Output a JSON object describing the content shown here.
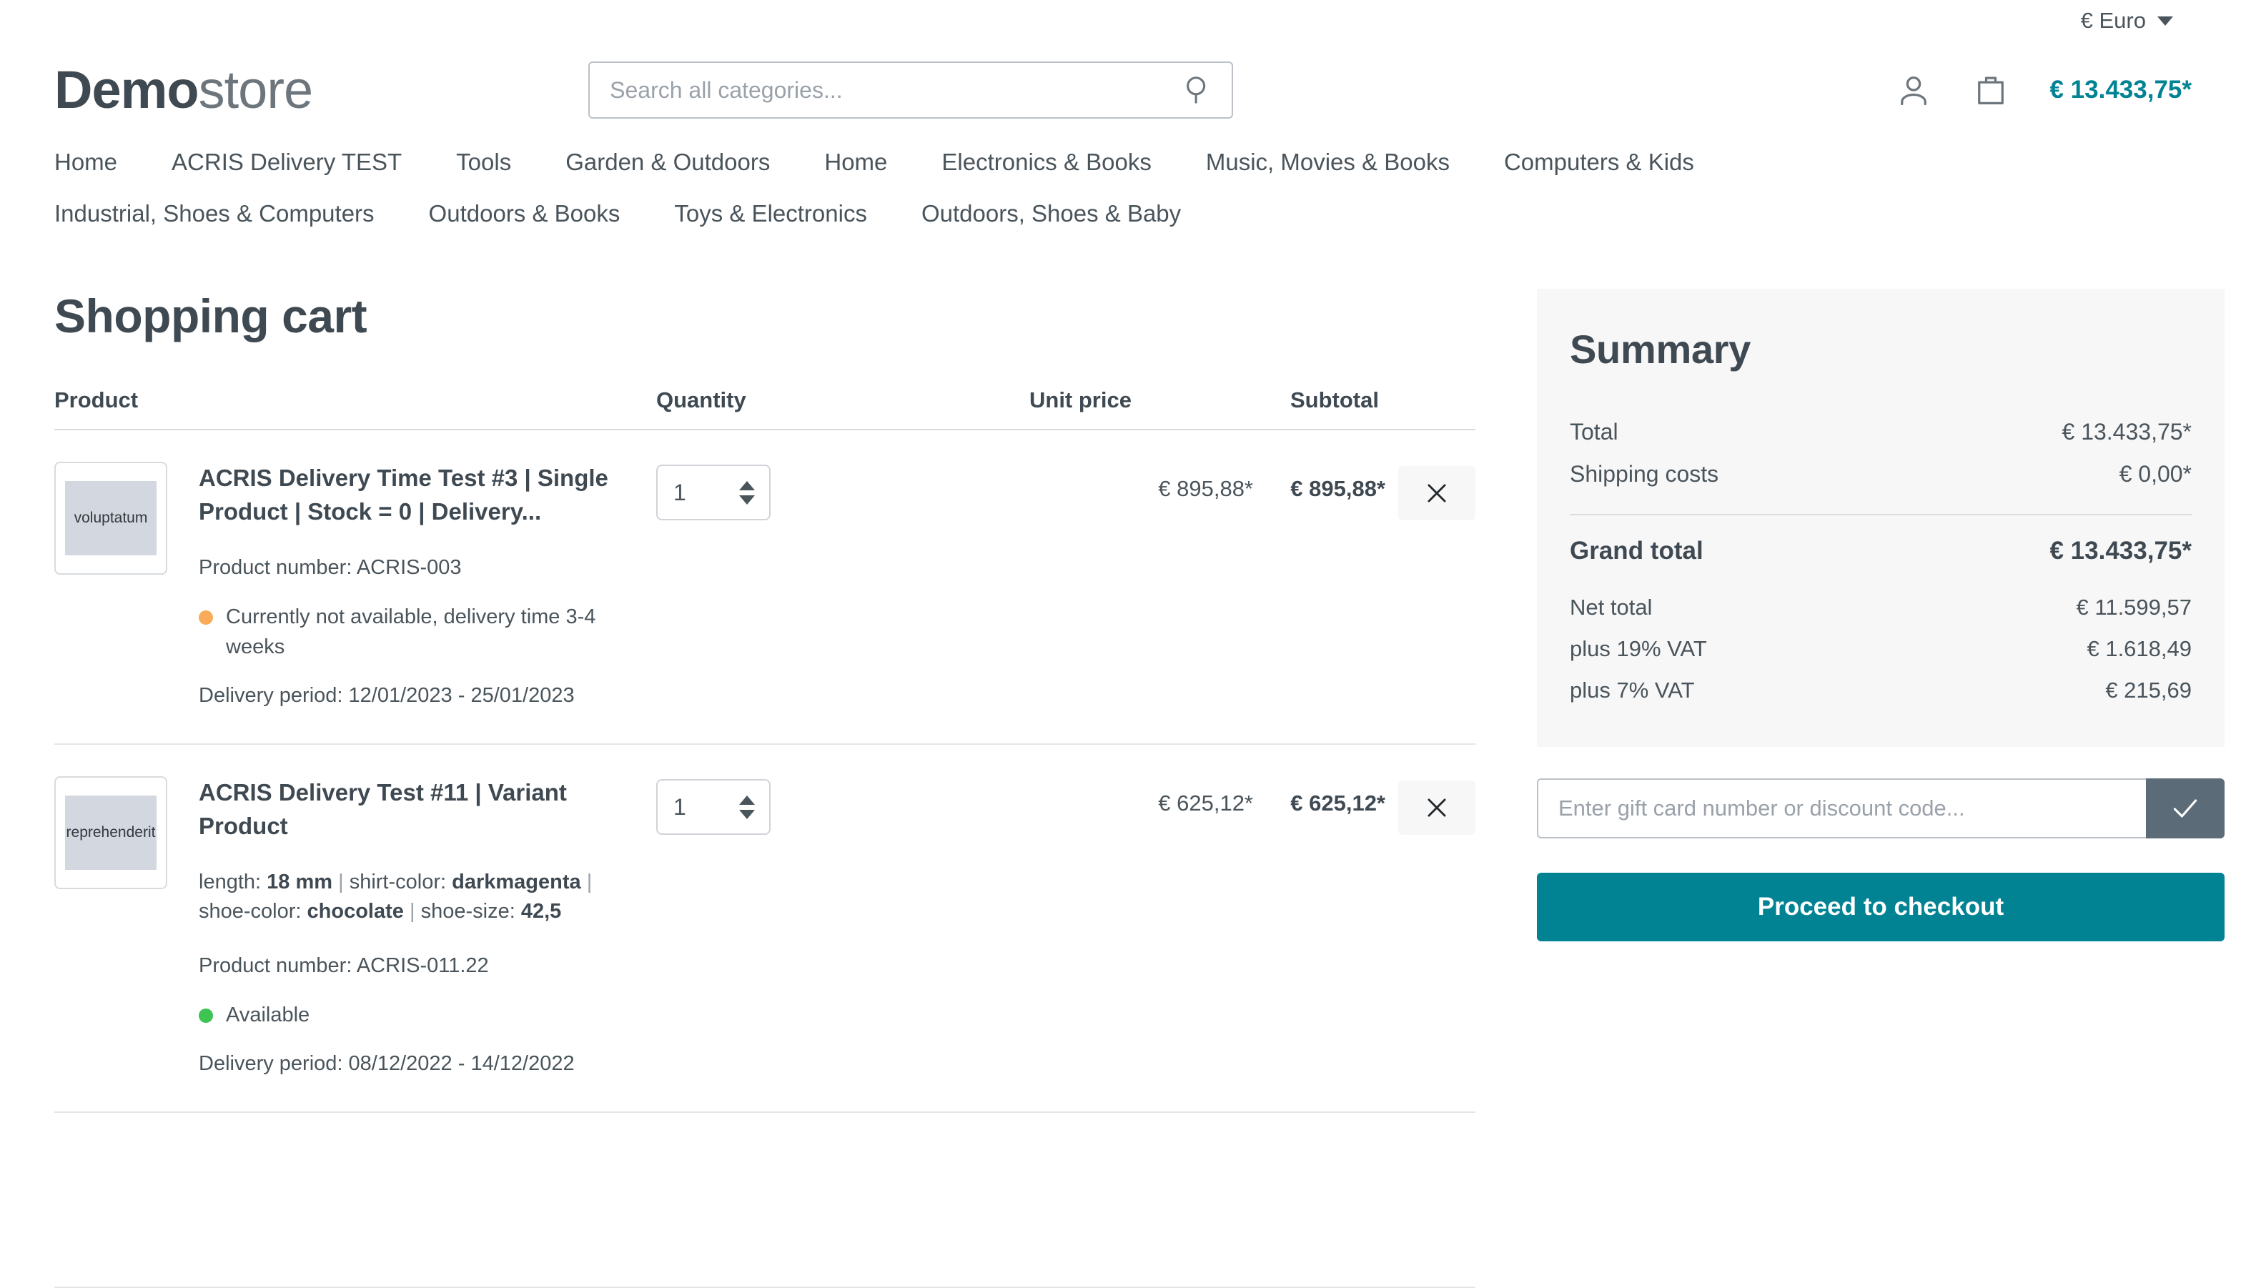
{
  "topbar": {
    "currency_label": "€ Euro",
    "currency_caret_icon": "chevron-down-icon"
  },
  "header": {
    "logo_bold": "Demo",
    "logo_light": "store",
    "search": {
      "placeholder": "Search all categories...",
      "value": "",
      "icon": "search-icon"
    },
    "account_icon": "user-icon",
    "cart_icon": "bag-icon",
    "cart_total": "€ 13.433,75*"
  },
  "nav": {
    "items": [
      {
        "label": "Home"
      },
      {
        "label": "ACRIS Delivery TEST"
      },
      {
        "label": "Tools"
      },
      {
        "label": "Garden & Outdoors"
      },
      {
        "label": "Home"
      },
      {
        "label": "Electronics & Books"
      },
      {
        "label": "Music, Movies & Books"
      },
      {
        "label": "Computers & Kids"
      },
      {
        "label": "Industrial, Shoes & Computers"
      },
      {
        "label": "Outdoors & Books"
      },
      {
        "label": "Toys & Electronics"
      },
      {
        "label": "Outdoors, Shoes & Baby"
      }
    ]
  },
  "cart": {
    "page_title": "Shopping cart",
    "columns": {
      "product": "Product",
      "quantity": "Quantity",
      "unit_price": "Unit price",
      "subtotal": "Subtotal"
    },
    "items": [
      {
        "thumb_text": "voluptatum",
        "title": "ACRIS Delivery Time Test #3 | Single Product | Stock = 0 | Delivery...",
        "variants": null,
        "product_number": "Product number: ACRIS-003",
        "stock_status": "Currently not available, delivery time 3-4 weeks",
        "stock_state": "warn",
        "stock_dot_color": "#f8ac59",
        "delivery_period": "Delivery period: 12/01/2023 - 25/01/2023",
        "quantity": "1",
        "unit_price": "€ 895,88*",
        "subtotal": "€ 895,88*",
        "remove_icon": "close-icon"
      },
      {
        "thumb_text": "reprehenderit",
        "title": "ACRIS Delivery Test #11 | Variant Product",
        "variants": [
          {
            "name": "length:",
            "value": "18 mm"
          },
          {
            "name": "shirt-color:",
            "value": "darkmagenta"
          },
          {
            "name": "shoe-color:",
            "value": "chocolate"
          },
          {
            "name": "shoe-size:",
            "value": "42,5"
          }
        ],
        "product_number": "Product number: ACRIS-011.22",
        "stock_status": "Available",
        "stock_state": "ok",
        "stock_dot_color": "#3dc453",
        "delivery_period": "Delivery period: 08/12/2022 - 14/12/2022",
        "quantity": "1",
        "unit_price": "€ 625,12*",
        "subtotal": "€ 625,12*",
        "remove_icon": "close-icon"
      }
    ]
  },
  "summary": {
    "title": "Summary",
    "rows": [
      {
        "label": "Total",
        "value": "€ 13.433,75*"
      },
      {
        "label": "Shipping costs",
        "value": "€ 0,00*"
      }
    ],
    "grand_total": {
      "label": "Grand total",
      "value": "€ 13.433,75*"
    },
    "tax_rows": [
      {
        "label": "Net total",
        "value": "€ 11.599,57"
      },
      {
        "label": "plus 19% VAT",
        "value": "€ 1.618,49"
      },
      {
        "label": "plus 7% VAT",
        "value": "€ 215,69"
      }
    ],
    "gift_card": {
      "placeholder": "Enter gift card number or discount code...",
      "value": "",
      "submit_icon": "check-icon"
    },
    "checkout_label": "Proceed to checkout"
  },
  "colors": {
    "accent_teal": "#018393",
    "text_dark": "#3f4952",
    "text_body": "#4a545b",
    "panel_bg": "#f7f7f8",
    "status_warn": "#f8ac59",
    "status_ok": "#3dc453",
    "gift_submit_bg": "#5b6b77"
  }
}
